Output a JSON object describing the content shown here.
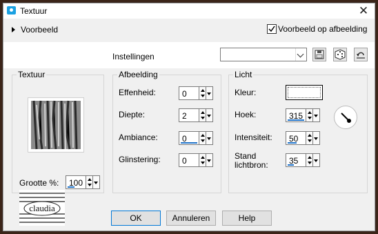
{
  "window": {
    "title": "Textuur",
    "close": "✕"
  },
  "preview": {
    "toggle_label": "Voorbeeld",
    "on_image_checked": true,
    "on_image_label": "Voorbeeld op afbeelding"
  },
  "settings": {
    "label": "Instellingen",
    "preset_value": "",
    "buttons": [
      "save-icon",
      "random-icon",
      "reset-icon"
    ]
  },
  "texture": {
    "title": "Textuur",
    "size_label": "Grootte %:",
    "size_value": "100"
  },
  "image_group": {
    "title": "Afbeelding",
    "fields": [
      {
        "label": "Effenheid:",
        "value": "0"
      },
      {
        "label": "Diepte:",
        "value": "2"
      },
      {
        "label": "Ambiance:",
        "value": "0"
      },
      {
        "label": "Glinstering:",
        "value": "0"
      }
    ]
  },
  "light": {
    "title": "Licht",
    "color_label": "Kleur:",
    "color_value": "#ffffff",
    "angle_label": "Hoek:",
    "angle_value": "315",
    "intensity_label": "Intensiteit:",
    "intensity_value": "50",
    "height_label": "Stand lichtbron:",
    "height_value": "35"
  },
  "buttons": {
    "ok": "OK",
    "cancel": "Annuleren",
    "help": "Help"
  },
  "logo_text": "claudia"
}
